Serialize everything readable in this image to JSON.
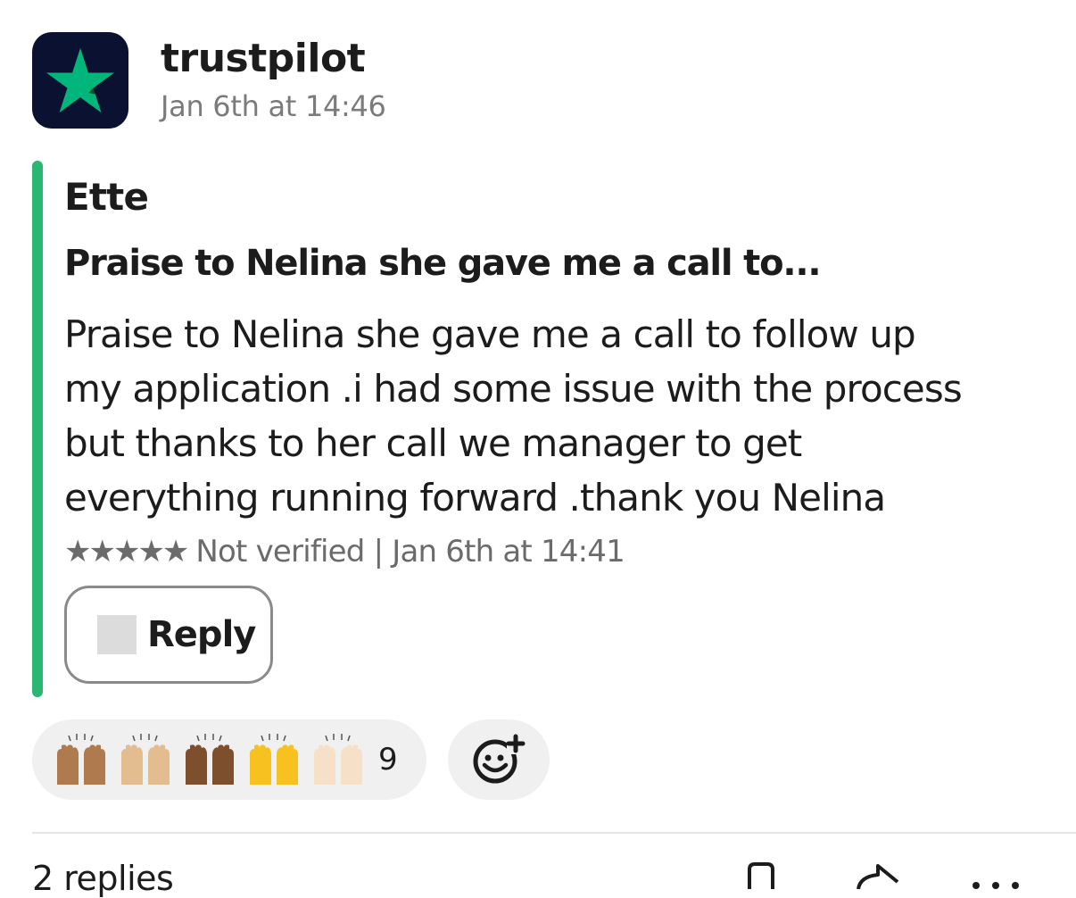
{
  "message": {
    "app_name": "trustpilot",
    "timestamp": "Jan 6th at 14:46"
  },
  "review": {
    "reviewer": "Ette",
    "headline": "Praise to Nelina she gave me a call to...",
    "body_lines": [
      "Praise to Nelina she gave me a call to follow up",
      "my application .i had some issue with the process",
      "but thanks to her call we manager to get",
      "everything running forward .thank you Nelina"
    ],
    "stars": "★★★★★",
    "rating": 5,
    "meta": "Not verified | Jan 6th at 14:41",
    "reply_label": "Reply"
  },
  "reactions": {
    "count": "9",
    "emoji": [
      "raised-hands-medium",
      "raised-hands-medium-light",
      "raised-hands-medium-dark",
      "raised-hands-yellow",
      "raised-hands-light"
    ]
  },
  "thread": {
    "replies_label": "2 replies"
  },
  "colors": {
    "accent": "#2bb673",
    "star_green": "#00b67a",
    "avatar_bg": "#0b1130"
  },
  "icons": [
    "trustpilot-star-icon",
    "add-reaction-icon",
    "bookmark-icon",
    "share-icon",
    "more-icon"
  ]
}
